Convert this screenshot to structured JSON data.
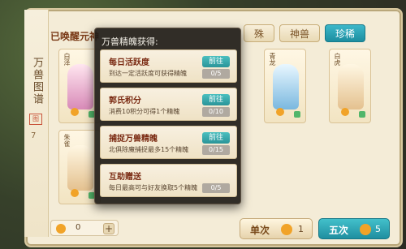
{
  "header": {
    "awakened_text": "已唤醒元神",
    "tabs": [
      "殊",
      "神兽",
      "珍稀"
    ],
    "active_tab_index": 2
  },
  "side": {
    "title": "万兽图谱",
    "seal": "图",
    "page_num": "7"
  },
  "cards": [
    {
      "tag": "白泽",
      "color": "pink"
    },
    {
      "tag": "青龙",
      "color": "blue"
    },
    {
      "tag": "白虎",
      "color": "tan"
    },
    {
      "tag": "朱雀",
      "color": "tan"
    }
  ],
  "dialog": {
    "title": "万兽精魄获得:",
    "rows": [
      {
        "name": "每日活跃度",
        "desc": "到达一定活跃度可获得精魄",
        "go_label": "前往",
        "progress": "0/5"
      },
      {
        "name": "郭氏积分",
        "desc": "消费10积分可得1个精魄",
        "go_label": "前往",
        "progress": "0/10"
      },
      {
        "name": "捕捉万兽精魄",
        "desc": "北俱除魔捕捉最多15个精魄",
        "go_label": "前往",
        "progress": "0/15"
      },
      {
        "name": "互助赠送",
        "desc": "每日最高可与好友换取5个精魄",
        "go_label": "",
        "progress": "0/5"
      }
    ]
  },
  "bottom": {
    "currency_value": "0",
    "single_label": "单次",
    "single_count": "1",
    "five_label": "五次",
    "five_count": "5"
  }
}
